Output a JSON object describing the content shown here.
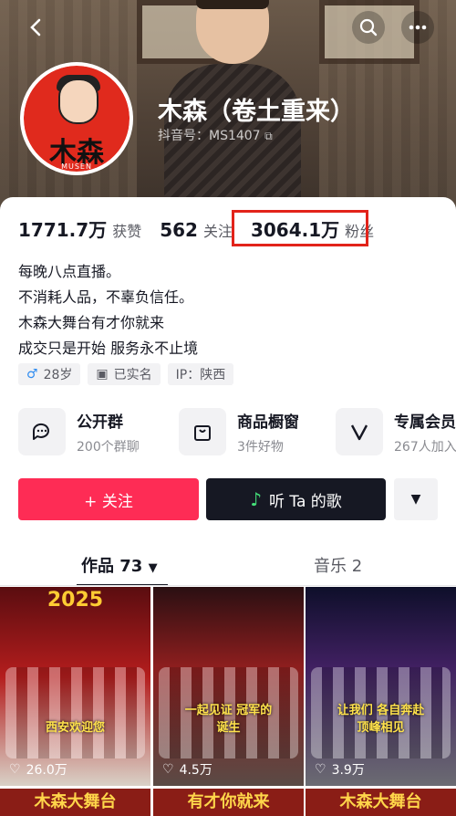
{
  "header": {
    "back_icon": "chevron-left-icon",
    "search_icon": "search-icon",
    "more_icon": "more-horizontal-icon"
  },
  "profile": {
    "name": "木森（卷土重来）",
    "douyin_id": "抖音号：MS1407",
    "avatar_text": "木森",
    "avatar_sub": "MUSEN"
  },
  "stats": [
    {
      "value": "1771.7万",
      "label": "获赞"
    },
    {
      "value": "562",
      "label": "关注"
    },
    {
      "value": "3064.1万",
      "label": "粉丝"
    }
  ],
  "bio": [
    "每晚八点直播。",
    "不消耗人品，不辜负信任。",
    "木森大舞台有才你就来",
    "成交只是开始 服务永不止境"
  ],
  "tags": [
    {
      "icon": "male-icon",
      "text": "28岁"
    },
    {
      "icon": "id-card-icon",
      "text": "已实名"
    },
    {
      "icon": "",
      "text": "IP：陕西"
    }
  ],
  "services": [
    {
      "icon": "chat-bubbles-icon",
      "title": "公开群",
      "sub": "200个群聊"
    },
    {
      "icon": "shopping-bag-icon",
      "title": "商品橱窗",
      "sub": "3件好物"
    },
    {
      "icon": "v-badge-icon",
      "title": "专属会员",
      "sub": "267人加入"
    }
  ],
  "actions": {
    "follow": "+ 关注",
    "song": "听 Ta 的歌"
  },
  "tabs": {
    "works": "作品 73",
    "music": "音乐 2"
  },
  "videos": [
    {
      "caption": "2025",
      "likes": "26.0万",
      "sticker": "西安欢迎您"
    },
    {
      "caption": "",
      "likes": "4.5万",
      "sticker": "一起见证 冠军的诞生"
    },
    {
      "caption": "",
      "likes": "3.9万",
      "sticker": "让我们 各自奔赴 顶峰相见"
    }
  ],
  "video_row2": [
    "木森大舞台",
    "有才你就来",
    "木森大舞台"
  ],
  "colors": {
    "accent": "#fe2c55",
    "highlight_box": "#e2231a",
    "dark_button": "#161823"
  }
}
